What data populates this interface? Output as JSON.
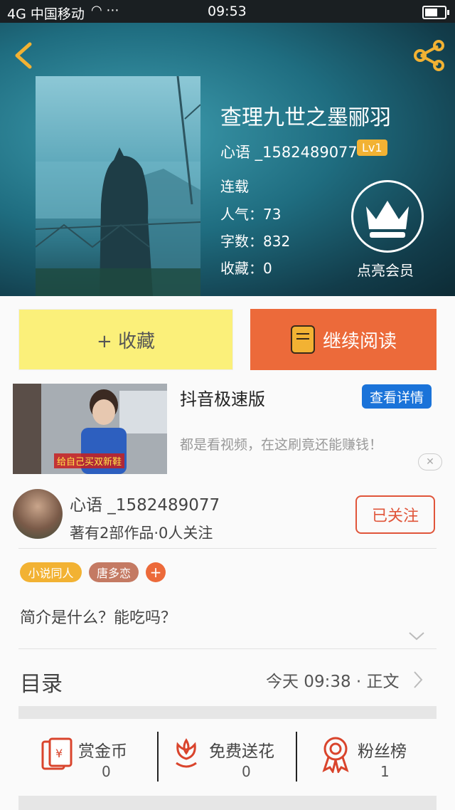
{
  "status_bar": {
    "carrier": "4G 中国移动",
    "time": "09:53"
  },
  "header": {
    "back_icon": "chevron-left-icon",
    "share_icon": "share-icon"
  },
  "book": {
    "title": "查理九世之墨郦羽",
    "author": "心语 _1582489077",
    "level": "Lv1",
    "status": "连载",
    "popularity": "人气：73",
    "word_count": "字数：832",
    "favorites": "收藏：0",
    "vip_label": "点亮会员"
  },
  "actions": {
    "collect_label": "+ 收藏",
    "read_label": "继续阅读"
  },
  "ad": {
    "caption": "给自己买双新鞋",
    "title": "抖音极速版",
    "button": "查看详情",
    "description": "都是看视频，在这刷竟还能赚钱！"
  },
  "author_card": {
    "name": "心语 _1582489077",
    "meta": "著有2部作品·0人关注",
    "follow_label": "已关注"
  },
  "tags": [
    "小说同人",
    "唐多恋"
  ],
  "intro": "简介是什么？能吃吗？",
  "catalog": {
    "label": "目录",
    "update": "今天 09:38 · 正文"
  },
  "stats": [
    {
      "label": "赏金币",
      "value": "0",
      "icon": "red-envelope-icon"
    },
    {
      "label": "免费送花",
      "value": "0",
      "icon": "flower-icon"
    },
    {
      "label": "粉丝榜",
      "value": "1",
      "icon": "medal-icon"
    }
  ],
  "colors": {
    "accent_orange": "#ec6a3a",
    "collect_yellow": "#fbf07a",
    "ad_blue": "#1a73d9",
    "follow_red": "#e0553a",
    "icon_yellow": "#f2b233"
  }
}
